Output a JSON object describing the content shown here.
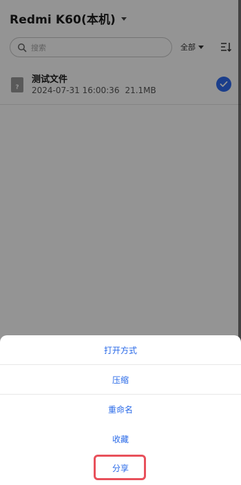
{
  "header": {
    "device_title": "Redmi K60(本机)"
  },
  "search": {
    "placeholder": "搜索"
  },
  "filter": {
    "label": "全部"
  },
  "files": [
    {
      "name": "测试文件",
      "icon_glyph": "?",
      "date": "2024-07-31 16:00:36",
      "size": "21.1MB",
      "selected": true
    }
  ],
  "action_sheet": {
    "items": [
      {
        "label": "打开方式"
      },
      {
        "label": "压缩"
      },
      {
        "label": "重命名"
      },
      {
        "label": "收藏"
      },
      {
        "label": "分享"
      }
    ],
    "highlighted_item": "分享"
  },
  "colors": {
    "accent": "#2a6ae8",
    "checkbox": "#2f6cf0",
    "highlight": "#e8505b"
  }
}
